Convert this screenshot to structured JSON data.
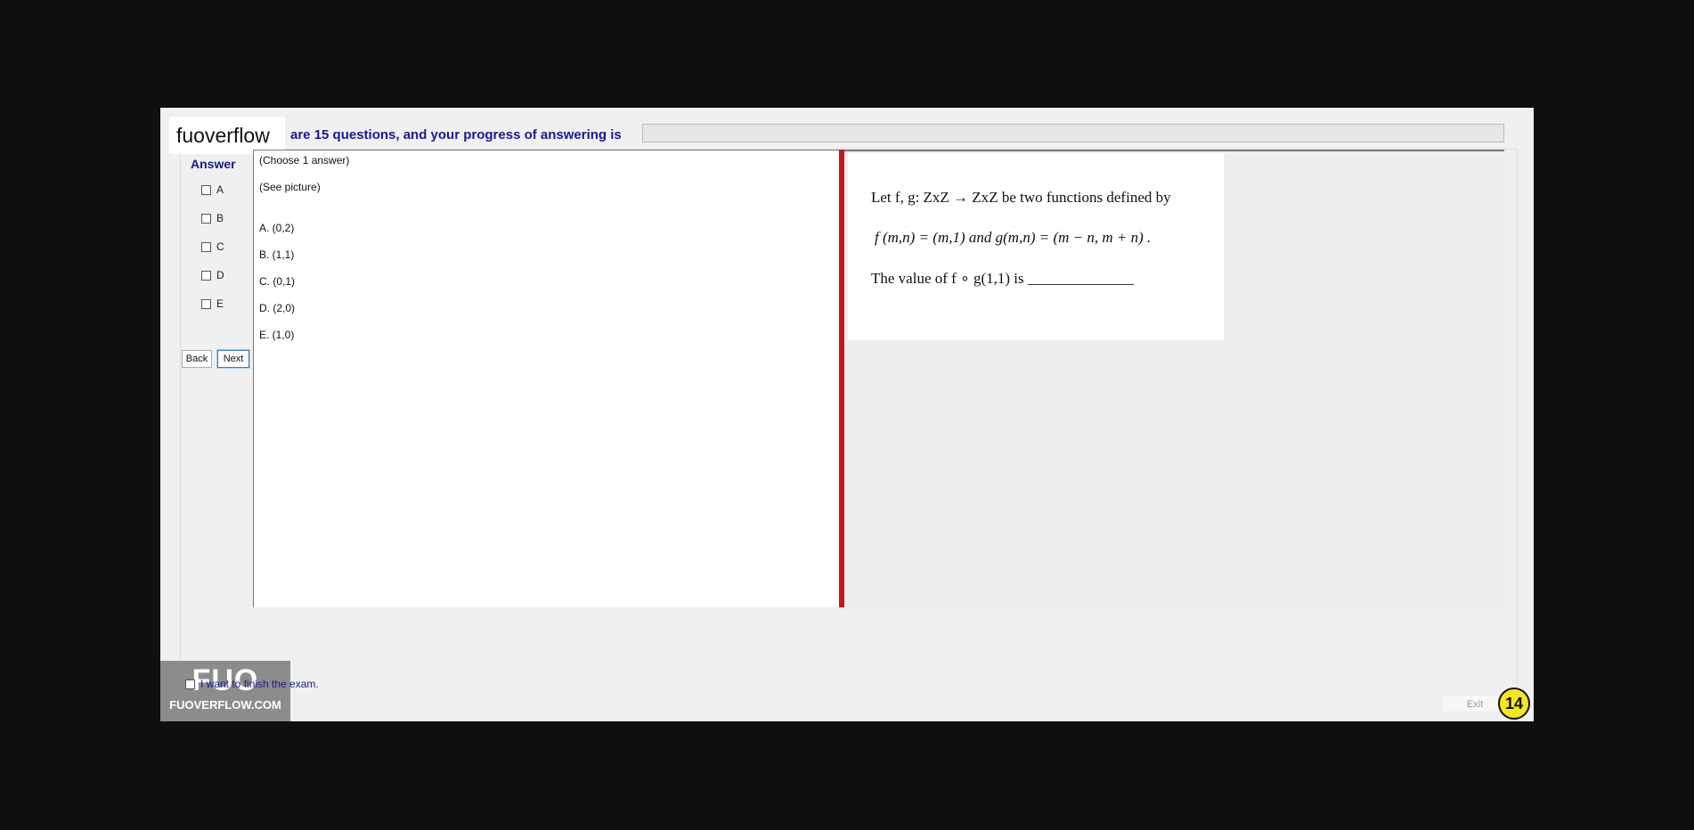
{
  "header": {
    "brand": "fuoverflow",
    "progress_text": "are 15 questions, and your progress of answering is",
    "progress_fraction": 0
  },
  "answer_panel": {
    "heading": "Answer",
    "options": [
      {
        "label": "A",
        "checked": false
      },
      {
        "label": "B",
        "checked": false
      },
      {
        "label": "C",
        "checked": false
      },
      {
        "label": "D",
        "checked": false
      },
      {
        "label": "E",
        "checked": false
      }
    ],
    "back_label": "Back",
    "next_label": "Next"
  },
  "question": {
    "instruction": "(Choose 1 answer)",
    "see_picture": "(See picture)",
    "choices": [
      "A.  (0,2)",
      "B.  (1,1)",
      "C.  (0,1)",
      "D.  (2,0)",
      "E.  (1,0)"
    ]
  },
  "picture": {
    "line1": "Let f, g: ZxZ → ZxZ be two functions defined by",
    "line2": "f (m,n) = (m,1)  and  g(m,n) = (m − n, m + n) .",
    "line3": "The value of   f ∘ g(1,1) is ______________"
  },
  "footer": {
    "logo_big": "FUO",
    "logo_small": "FUOVERFLOW.COM",
    "finish_label": "I want to finish the exam.",
    "exit_label": "Exit",
    "question_number": "14"
  },
  "colors": {
    "accent_text": "#1a1a8c",
    "splitter": "#c9161a",
    "badge": "#f5e625"
  }
}
